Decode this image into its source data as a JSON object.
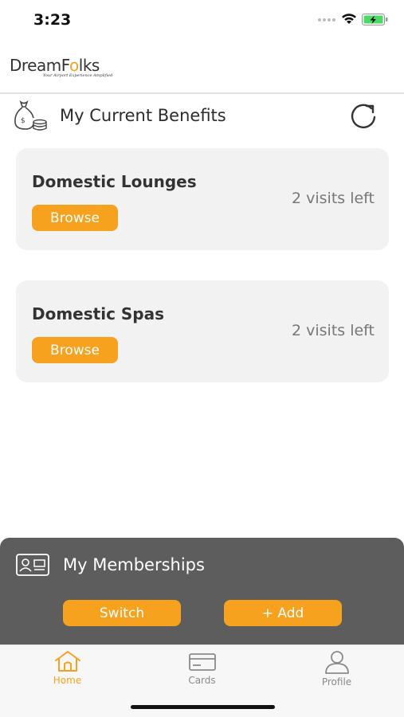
{
  "status_bar": {
    "time": "3:23"
  },
  "brand": {
    "name_part1": "DreamF",
    "name_part2": "lks",
    "tagline": "Your Airport Experience Amplified"
  },
  "benefits": {
    "title": "My Current Benefits",
    "items": [
      {
        "title": "Domestic Lounges",
        "visits_left": "2 visits left",
        "button_label": "Browse"
      },
      {
        "title": "Domestic Spas",
        "visits_left": "2 visits left",
        "button_label": "Browse"
      }
    ]
  },
  "memberships": {
    "title": "My Memberships",
    "switch_label": "Switch",
    "add_label": "+ Add"
  },
  "tabs": [
    {
      "label": "Home",
      "icon": "home-icon",
      "active": true
    },
    {
      "label": "Cards",
      "icon": "card-icon",
      "active": false
    },
    {
      "label": "Profile",
      "icon": "profile-icon",
      "active": false
    }
  ],
  "colors": {
    "accent": "#f6a21e",
    "panel": "#5d5d5d",
    "card_bg": "#f2f2f2",
    "inactive_tab": "#8a8a8a"
  }
}
